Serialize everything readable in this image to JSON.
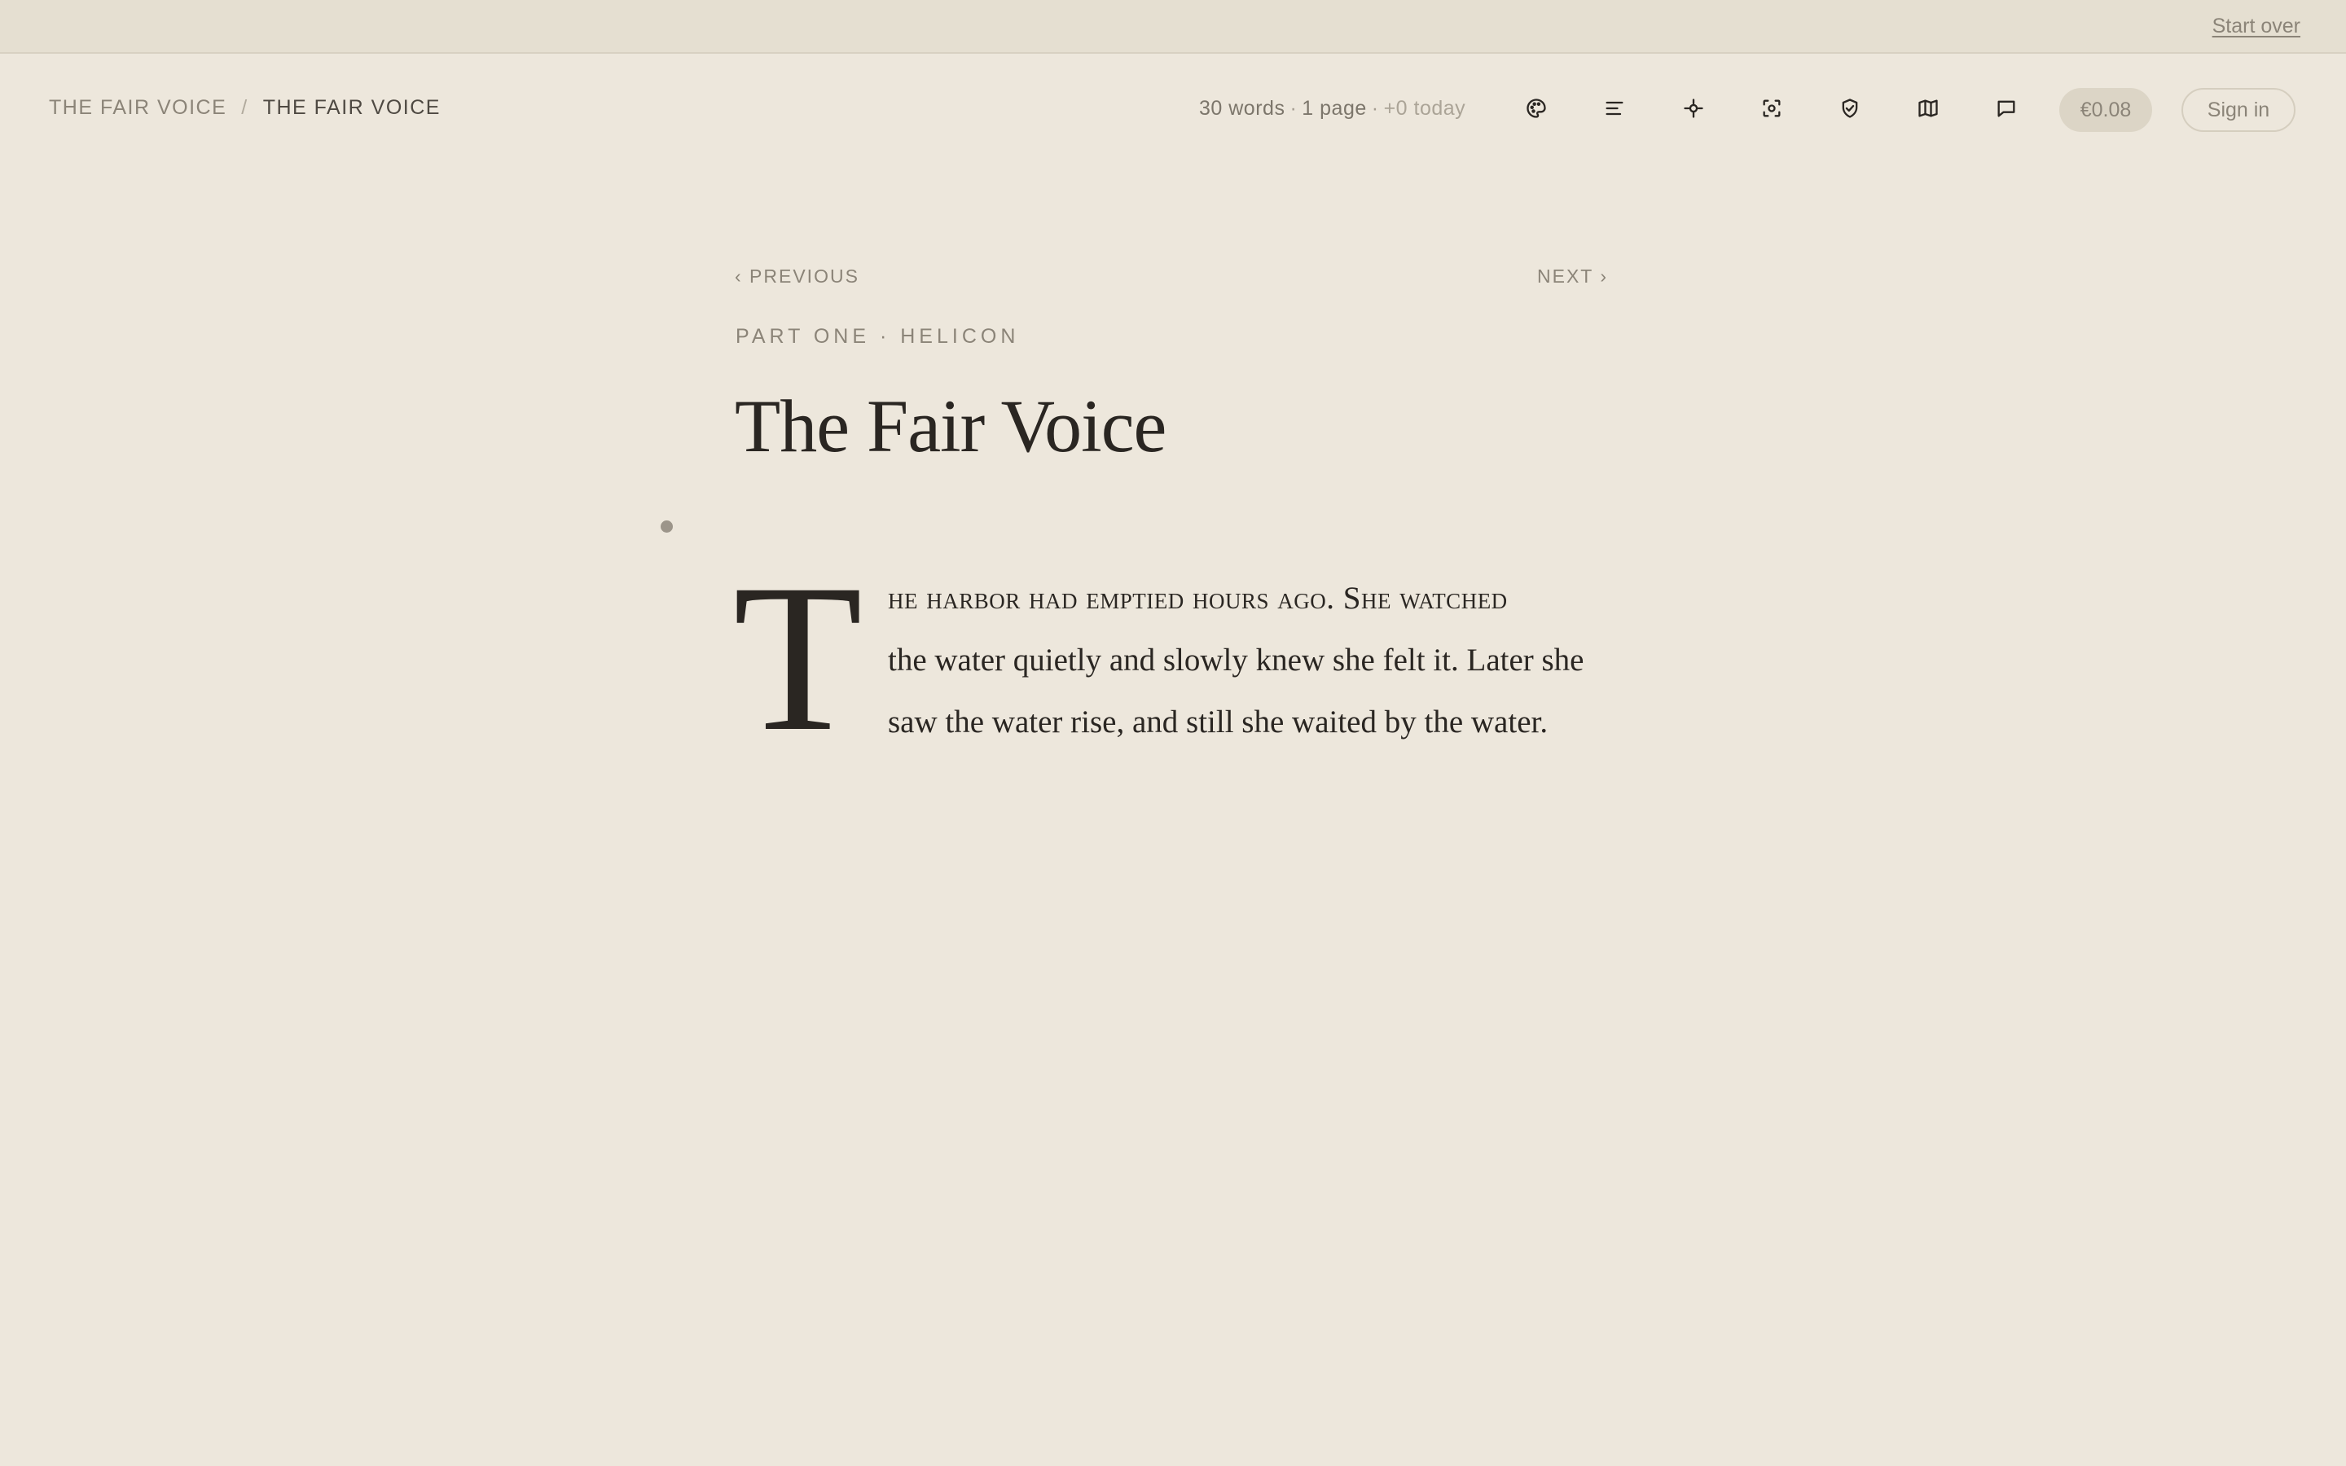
{
  "topbar": {
    "start_over_label": "Start over"
  },
  "breadcrumb": {
    "parent": "THE FAIR VOICE",
    "separator": "/",
    "current": "THE FAIR VOICE"
  },
  "stats": {
    "words": "30 words",
    "pages": "1 page",
    "today": "+0 today"
  },
  "toolbar": {
    "icons": [
      "palette-icon",
      "align-icon",
      "focus-icon",
      "screenshot-icon",
      "shield-icon",
      "map-icon",
      "comment-icon"
    ],
    "price": "€0.08",
    "signin_label": "Sign in"
  },
  "chapter": {
    "prev_label": "‹ PREVIOUS",
    "next_label": "NEXT ›",
    "part_label": "PART ONE · HELICON",
    "title": "The Fair Voice"
  },
  "body": {
    "dropcap": "T",
    "line1": "he harbor had emptied hours ago. She watched",
    "line2": "the water quietly and slowly knew she felt it. Later she",
    "line3": "saw the water rise, and still she waited by the water."
  },
  "colors": {
    "background": "#ede7dc",
    "topbar": "#e5dfd1",
    "text": "#2a2622",
    "muted": "#8b8478",
    "pill": "#dcd5c6"
  }
}
